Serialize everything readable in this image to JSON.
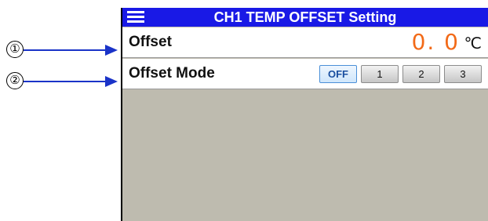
{
  "callouts": [
    {
      "number": "①"
    },
    {
      "number": "②"
    }
  ],
  "titlebar": {
    "title": "CH1 TEMP OFFSET Setting",
    "menu_icon": "hamburger-menu-icon"
  },
  "offset": {
    "label": "Offset",
    "value": "0. 0",
    "unit": "℃",
    "value_color": "#f26a18"
  },
  "offset_mode": {
    "label": "Offset Mode",
    "selected": "OFF",
    "options": [
      "OFF",
      "1",
      "2",
      "3"
    ]
  },
  "colors": {
    "titlebar_bg": "#1919e6",
    "empty_area_bg": "#bebbaf",
    "arrow_color": "#1a33c8"
  }
}
